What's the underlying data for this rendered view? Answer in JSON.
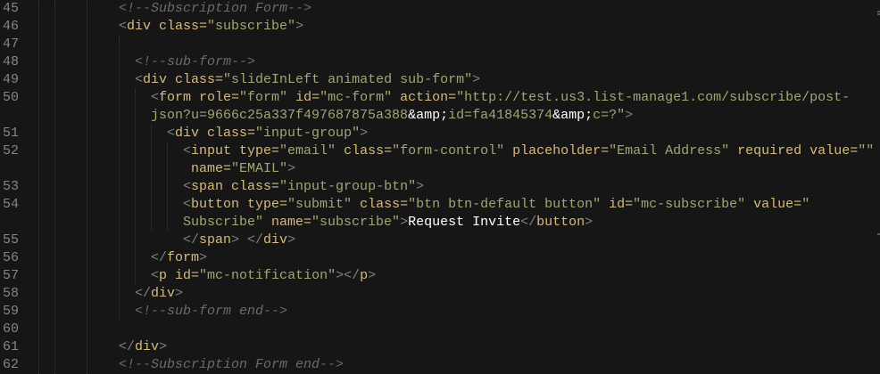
{
  "editor": {
    "theme_colors": {
      "background": "#161616",
      "line_number": "#858585",
      "punctuation": "#808080",
      "tag": "#d7ba7d",
      "string": "#a3a574",
      "text": "#ffffff",
      "comment": "#6a6a6a"
    },
    "rows": [
      {
        "n": "45",
        "segs": [
          [
            "c",
            "<!--Subscription Form-->"
          ]
        ]
      },
      {
        "n": "46",
        "segs": [
          [
            "p",
            "<"
          ],
          [
            "t",
            "div "
          ],
          [
            "a",
            "class="
          ],
          [
            "s",
            "\"subscribe\""
          ],
          [
            "p",
            ">"
          ]
        ]
      },
      {
        "n": "47",
        "segs": []
      },
      {
        "n": "48",
        "segs": [
          [
            "c",
            "  <!--sub-form-->"
          ]
        ]
      },
      {
        "n": "49",
        "segs": [
          [
            "p",
            "  <"
          ],
          [
            "t",
            "div "
          ],
          [
            "a",
            "class="
          ],
          [
            "s",
            "\"slideInLeft animated sub-form\""
          ],
          [
            "p",
            ">"
          ]
        ]
      },
      {
        "n": "50",
        "segs": [
          [
            "p",
            "    <"
          ],
          [
            "t",
            "form "
          ],
          [
            "a",
            "role="
          ],
          [
            "s",
            "\"form\" "
          ],
          [
            "a",
            "id="
          ],
          [
            "s",
            "\"mc-form\" "
          ],
          [
            "a",
            "action="
          ],
          [
            "s",
            "\"http://test.us3.list-manage1.com/subscribe/post-"
          ]
        ]
      },
      {
        "n": "",
        "segs": [
          [
            "s",
            "    json?u=9666c25a337f497687875a388"
          ],
          [
            "x",
            "&amp;"
          ],
          [
            "s",
            "id=fa41845374"
          ],
          [
            "x",
            "&amp;"
          ],
          [
            "s",
            "c=?\""
          ],
          [
            "p",
            ">"
          ]
        ]
      },
      {
        "n": "51",
        "segs": [
          [
            "p",
            "      <"
          ],
          [
            "t",
            "div "
          ],
          [
            "a",
            "class="
          ],
          [
            "s",
            "\"input-group\""
          ],
          [
            "p",
            ">"
          ]
        ]
      },
      {
        "n": "52",
        "segs": [
          [
            "p",
            "        <"
          ],
          [
            "t",
            "input "
          ],
          [
            "a",
            "type="
          ],
          [
            "s",
            "\"email\" "
          ],
          [
            "a",
            "class="
          ],
          [
            "s",
            "\"form-control\" "
          ],
          [
            "a",
            "placeholder="
          ],
          [
            "s",
            "\"Email Address\" "
          ],
          [
            "a",
            "required value="
          ],
          [
            "s",
            "\"\""
          ]
        ]
      },
      {
        "n": "",
        "segs": [
          [
            "a",
            "         name="
          ],
          [
            "s",
            "\"EMAIL\""
          ],
          [
            "p",
            ">"
          ]
        ]
      },
      {
        "n": "53",
        "segs": [
          [
            "p",
            "        <"
          ],
          [
            "t",
            "span "
          ],
          [
            "a",
            "class="
          ],
          [
            "s",
            "\"input-group-btn\""
          ],
          [
            "p",
            ">"
          ]
        ]
      },
      {
        "n": "54",
        "segs": [
          [
            "p",
            "        <"
          ],
          [
            "t",
            "button "
          ],
          [
            "a",
            "type="
          ],
          [
            "s",
            "\"submit\" "
          ],
          [
            "a",
            "class="
          ],
          [
            "s",
            "\"btn btn-default button\" "
          ],
          [
            "a",
            "id="
          ],
          [
            "s",
            "\"mc-subscribe\" "
          ],
          [
            "a",
            "value="
          ],
          [
            "s",
            "\""
          ]
        ]
      },
      {
        "n": "",
        "segs": [
          [
            "s",
            "        Subscribe\" "
          ],
          [
            "a",
            "name="
          ],
          [
            "s",
            "\"subscribe\""
          ],
          [
            "p",
            ">"
          ],
          [
            "x",
            "Request Invite"
          ],
          [
            "p",
            "</"
          ],
          [
            "t",
            "button"
          ],
          [
            "p",
            ">"
          ]
        ]
      },
      {
        "n": "55",
        "segs": [
          [
            "p",
            "        </"
          ],
          [
            "t",
            "span"
          ],
          [
            "p",
            "> </"
          ],
          [
            "t",
            "div"
          ],
          [
            "p",
            ">"
          ]
        ]
      },
      {
        "n": "56",
        "segs": [
          [
            "p",
            "    </"
          ],
          [
            "t",
            "form"
          ],
          [
            "p",
            ">"
          ]
        ]
      },
      {
        "n": "57",
        "segs": [
          [
            "p",
            "    <"
          ],
          [
            "t",
            "p "
          ],
          [
            "a",
            "id="
          ],
          [
            "s",
            "\"mc-notification\""
          ],
          [
            "p",
            "></"
          ],
          [
            "t",
            "p"
          ],
          [
            "p",
            ">"
          ]
        ]
      },
      {
        "n": "58",
        "segs": [
          [
            "p",
            "  </"
          ],
          [
            "t",
            "div"
          ],
          [
            "p",
            ">"
          ]
        ]
      },
      {
        "n": "59",
        "segs": [
          [
            "c",
            "  <!--sub-form end-->"
          ]
        ]
      },
      {
        "n": "60",
        "segs": []
      },
      {
        "n": "61",
        "segs": [
          [
            "p",
            "</"
          ],
          [
            "t",
            "div"
          ],
          [
            "p",
            ">"
          ]
        ]
      },
      {
        "n": "62",
        "segs": [
          [
            "c",
            "<!--Subscription Form end-->"
          ]
        ]
      }
    ]
  }
}
